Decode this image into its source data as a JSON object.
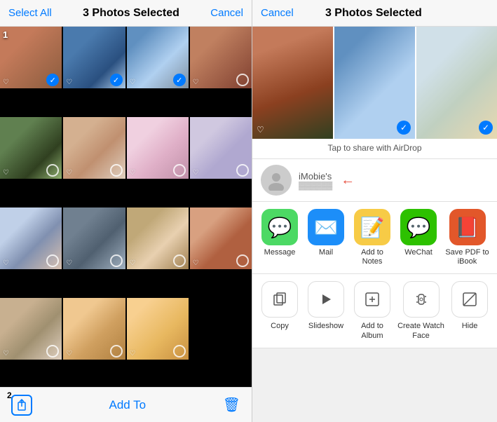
{
  "left": {
    "header": {
      "select_all": "Select All",
      "title": "3 Photos Selected",
      "cancel": "Cancel"
    },
    "footer": {
      "num_badge": "2",
      "add_to": "Add To"
    },
    "photos": [
      {
        "id": 1,
        "cls": "p1",
        "selected": true,
        "num": "1"
      },
      {
        "id": 2,
        "cls": "p2",
        "selected": true,
        "num": ""
      },
      {
        "id": 3,
        "cls": "p3",
        "selected": true,
        "num": ""
      },
      {
        "id": 4,
        "cls": "p4",
        "selected": false,
        "num": ""
      },
      {
        "id": 5,
        "cls": "p5",
        "selected": false,
        "num": ""
      },
      {
        "id": 6,
        "cls": "p6",
        "selected": false,
        "num": ""
      },
      {
        "id": 7,
        "cls": "p7",
        "selected": false,
        "num": ""
      },
      {
        "id": 8,
        "cls": "p8",
        "selected": false,
        "num": ""
      },
      {
        "id": 9,
        "cls": "p9",
        "selected": false,
        "num": ""
      },
      {
        "id": 10,
        "cls": "p10",
        "selected": false,
        "num": ""
      },
      {
        "id": 11,
        "cls": "p11",
        "selected": false,
        "num": ""
      },
      {
        "id": 12,
        "cls": "p12",
        "selected": false,
        "num": ""
      },
      {
        "id": 13,
        "cls": "p13",
        "selected": false,
        "num": ""
      },
      {
        "id": 14,
        "cls": "p14",
        "selected": false,
        "num": ""
      },
      {
        "id": 15,
        "cls": "p15",
        "selected": false,
        "num": ""
      }
    ]
  },
  "right": {
    "header": {
      "cancel": "Cancel",
      "title": "3 Photos Selected"
    },
    "selected_photos": [
      {
        "cls": "sp1",
        "checked": false,
        "heart": true
      },
      {
        "cls": "sp2",
        "checked": true,
        "heart": false
      },
      {
        "cls": "sp3",
        "checked": true,
        "heart": false
      }
    ],
    "airdrop_label": "Tap to share with AirDrop",
    "contact": {
      "name": "iMobie's"
    },
    "share_apps": [
      {
        "label": "Message",
        "icon": "💬",
        "cls": "icon-message"
      },
      {
        "label": "Mail",
        "icon": "✉️",
        "cls": "icon-mail"
      },
      {
        "label": "Add to Notes",
        "icon": "📝",
        "cls": "icon-notes"
      },
      {
        "label": "WeChat",
        "icon": "💬",
        "cls": "icon-wechat"
      },
      {
        "label": "Save PDF\nto iBook",
        "icon": "📕",
        "cls": "icon-ibooks"
      }
    ],
    "actions": [
      {
        "label": "Copy",
        "icon": "⧉"
      },
      {
        "label": "Slideshow",
        "icon": "▶"
      },
      {
        "label": "Add to Album",
        "icon": "➕"
      },
      {
        "label": "Create\nWatch Face",
        "icon": "⌚"
      },
      {
        "label": "Hide",
        "icon": "⊡"
      }
    ]
  }
}
